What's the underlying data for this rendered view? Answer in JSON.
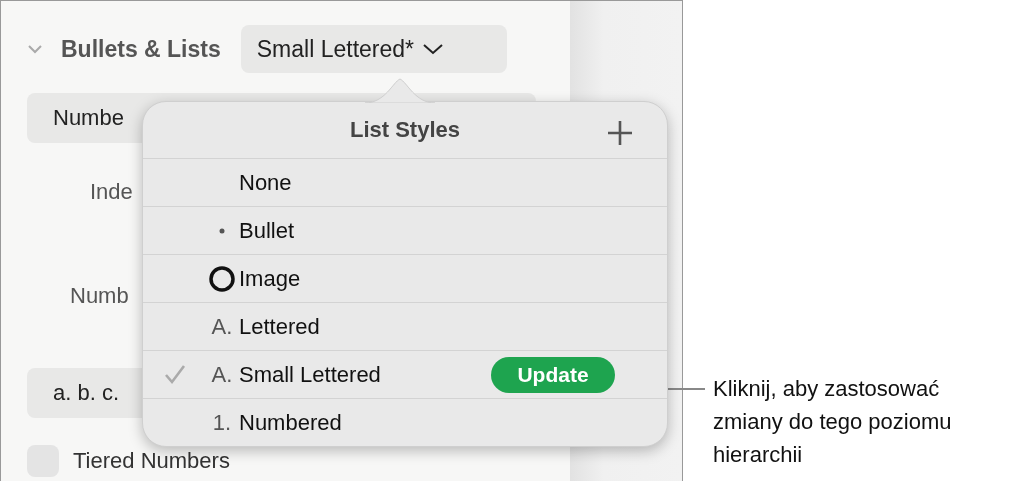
{
  "sidebar": {
    "section": {
      "title": "Bullets & Lists",
      "expanded": true,
      "style_button": "Small Lettered*"
    },
    "list_type_button": "Numbe",
    "labels": [
      "Inde",
      "Numb"
    ],
    "format_button": "a. b. c.",
    "tiered_numbers": {
      "label": "Tiered Numbers",
      "checked": false
    }
  },
  "popover": {
    "title": "List Styles",
    "items": [
      {
        "label": "None",
        "kind": "none",
        "selected": false
      },
      {
        "label": "Bullet",
        "kind": "bullet",
        "selected": false
      },
      {
        "label": "Image",
        "kind": "image",
        "selected": false
      },
      {
        "label": "Lettered",
        "kind": "text",
        "marker": "A.",
        "selected": false
      },
      {
        "label": "Small Lettered",
        "kind": "text",
        "marker": "A.",
        "selected": true,
        "action": "Update"
      },
      {
        "label": "Numbered",
        "kind": "text",
        "marker": "1.",
        "selected": false
      }
    ]
  },
  "callout": "Kliknij, aby zastosować zmiany do tego poziomu hierarchii"
}
